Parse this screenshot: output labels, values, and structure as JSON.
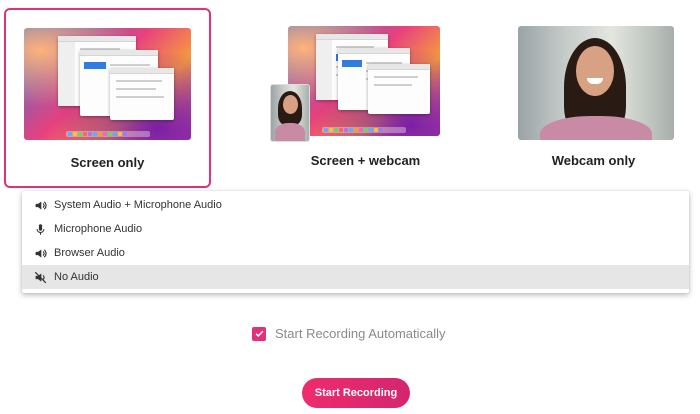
{
  "modes": [
    {
      "id": "screen",
      "label": "Screen only",
      "selected": true
    },
    {
      "id": "screen_webcam",
      "label": "Screen + webcam",
      "selected": false
    },
    {
      "id": "webcam",
      "label": "Webcam only",
      "selected": false
    }
  ],
  "audio_options": [
    {
      "label": "System Audio + Microphone Audio",
      "icon": "speaker-icon",
      "active": false
    },
    {
      "label": "Microphone Audio",
      "icon": "microphone-icon",
      "active": false
    },
    {
      "label": "Browser Audio",
      "icon": "speaker-icon",
      "active": false
    },
    {
      "label": "No Audio",
      "icon": "speaker-muted-icon",
      "active": true
    }
  ],
  "auto_start": {
    "label": "Start Recording Automatically",
    "checked": true
  },
  "start_button": {
    "label": "Start Recording"
  },
  "colors": {
    "accent": "#e0317a",
    "button": "#ee2c6e",
    "active_row": "#e6e6e6"
  }
}
